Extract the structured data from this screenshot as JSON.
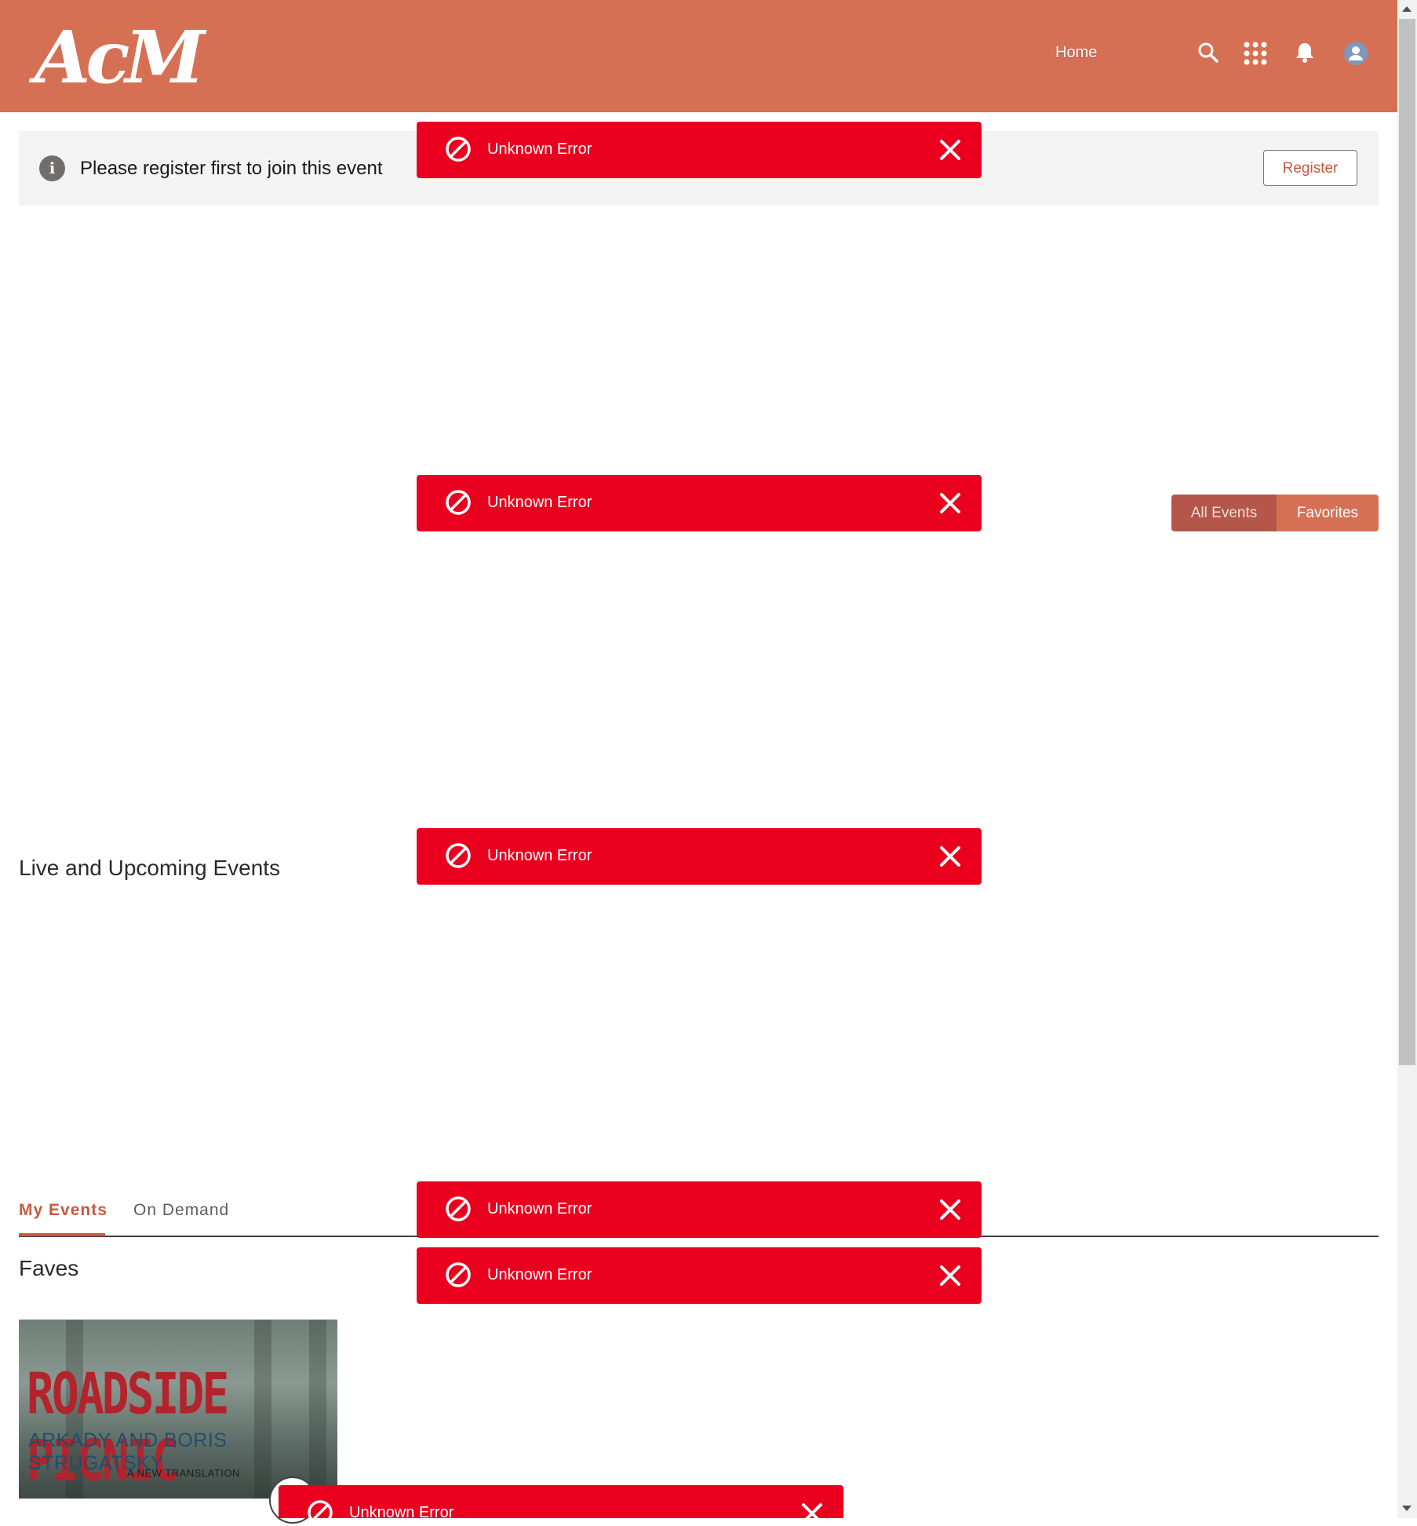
{
  "header": {
    "logo_text": "AcM",
    "nav": {
      "home_label": "Home"
    },
    "icons": [
      "search-icon",
      "app-launcher-icon",
      "notification-bell-icon",
      "user-avatar-icon"
    ],
    "background_color": "#d67055"
  },
  "info_banner": {
    "icon": "info-icon",
    "message": "Please register first to join this event",
    "register_label": "Register"
  },
  "toasts": [
    {
      "message": "Unknown Error",
      "icon": "ban-icon",
      "close_icon": "close-icon"
    },
    {
      "message": "Unknown Error",
      "icon": "ban-icon",
      "close_icon": "close-icon"
    },
    {
      "message": "Unknown Error",
      "icon": "ban-icon",
      "close_icon": "close-icon"
    },
    {
      "message": "Unknown Error",
      "icon": "ban-icon",
      "close_icon": "close-icon"
    },
    {
      "message": "Unknown Error",
      "icon": "ban-icon",
      "close_icon": "close-icon"
    },
    {
      "message": "Unknown Error",
      "icon": "ban-icon",
      "close_icon": "close-icon"
    }
  ],
  "toast_color": "#ea001e",
  "event_filter": {
    "options": [
      "All Events",
      "Favorites"
    ],
    "selected": "Favorites"
  },
  "live_section": {
    "title": "Live and Upcoming Events"
  },
  "tabs": {
    "items": [
      "My Events",
      "On Demand"
    ],
    "active": "My Events"
  },
  "faves": {
    "title": "Faves",
    "cards": [
      {
        "cover_title": "ROADSIDE PICNIC",
        "cover_author": "ARKADY AND BORIS STRUGATSKY",
        "cover_subtitle": "A NEW TRANSLATION"
      }
    ]
  }
}
